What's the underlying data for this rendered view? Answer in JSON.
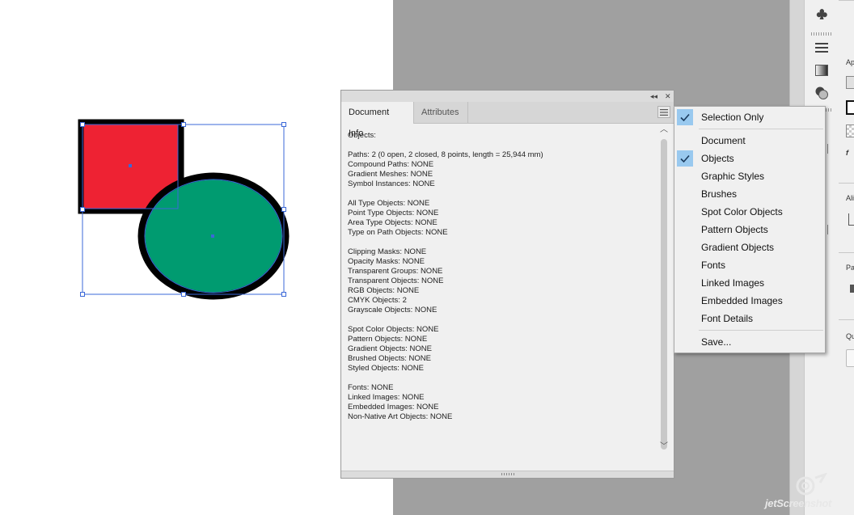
{
  "panel": {
    "tabs": [
      {
        "label": "Document Info",
        "active": true
      },
      {
        "label": "Attributes",
        "active": false
      }
    ],
    "controls": {
      "collapse": "◂◂",
      "close": "✕"
    },
    "lines": [
      "Objects:",
      "",
      "Paths: 2 (0 open, 2 closed, 8 points, length = 25,944 mm)",
      "Compound Paths: NONE",
      "Gradient Meshes: NONE",
      "Symbol Instances: NONE",
      "",
      "All Type Objects: NONE",
      "Point Type Objects: NONE",
      "Area Type Objects: NONE",
      "Type on Path Objects: NONE",
      "",
      "Clipping Masks: NONE",
      "Opacity Masks: NONE",
      "Transparent Groups: NONE",
      "Transparent Objects: NONE",
      "RGB Objects: NONE",
      "CMYK Objects: 2",
      "Grayscale Objects: NONE",
      "",
      "Spot Color Objects: NONE",
      "Pattern Objects: NONE",
      "Gradient Objects: NONE",
      "Brushed Objects: NONE",
      "Styled Objects: NONE",
      "",
      "Fonts: NONE",
      "Linked Images: NONE",
      "Embedded Images: NONE",
      "Non-Native Art Objects: NONE"
    ]
  },
  "flyout": {
    "items": [
      {
        "label": "Selection Only",
        "checked": true
      },
      {
        "label": "Document",
        "checked": false
      },
      {
        "label": "Objects",
        "checked": true
      },
      {
        "label": "Graphic Styles",
        "checked": false
      },
      {
        "label": "Brushes",
        "checked": false
      },
      {
        "label": "Spot Color Objects",
        "checked": false
      },
      {
        "label": "Pattern Objects",
        "checked": false
      },
      {
        "label": "Gradient Objects",
        "checked": false
      },
      {
        "label": "Fonts",
        "checked": false
      },
      {
        "label": "Linked Images",
        "checked": false
      },
      {
        "label": "Embedded Images",
        "checked": false
      },
      {
        "label": "Font Details",
        "checked": false
      },
      {
        "label": "Save...",
        "checked": false
      }
    ]
  },
  "far_panel": {
    "labels": [
      "Ap",
      "Ali",
      "Pa",
      "Qu"
    ]
  },
  "artwork": {
    "rect_fill": "#ee2233",
    "ellipse_fill": "#009b70",
    "stroke": "#000000",
    "selection_color": "#3b68d8"
  },
  "watermark": {
    "text": "jetScreenshot"
  },
  "colors": {
    "checked_bg": "#99c9ef",
    "panel_bg": "#f0f0f0",
    "pasteboard": "#a0a0a0"
  }
}
